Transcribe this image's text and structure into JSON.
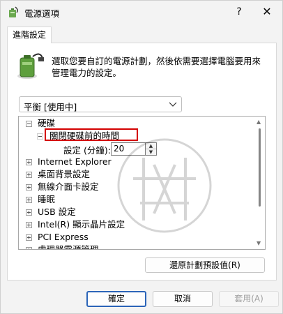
{
  "window": {
    "title": "電源選項",
    "help_glyph": "?",
    "close_glyph": "✕",
    "icon": "power-options-icon"
  },
  "tab": {
    "label": "進階設定"
  },
  "description": "選取您要自訂的電源計劃，然後依需要選擇電腦要用來管理電力的設定。",
  "plan_select": {
    "value": "平衡 [使用中]"
  },
  "tree": {
    "items": [
      {
        "label": "硬碟",
        "expander": "minus"
      },
      {
        "label": "關閉硬碟前的時間",
        "expander": "minus"
      },
      {
        "label": "Internet Explorer",
        "expander": "plus"
      },
      {
        "label": "桌面背景設定",
        "expander": "plus"
      },
      {
        "label": "無線介面卡設定",
        "expander": "plus"
      },
      {
        "label": "睡眠",
        "expander": "plus"
      },
      {
        "label": "USB 設定",
        "expander": "plus"
      },
      {
        "label": "Intel(R) 顯示晶片設定",
        "expander": "plus"
      },
      {
        "label": "PCI Express",
        "expander": "plus"
      },
      {
        "label": "處理器電源管理",
        "expander": "plus"
      }
    ],
    "setting": {
      "label": "設定 (分鐘):",
      "value": "20"
    },
    "highlight_color": "#d40000"
  },
  "buttons": {
    "restore": "還原計劃預設值(R)",
    "ok": "確定",
    "cancel": "取消",
    "apply": "套用(A)"
  },
  "colors": {
    "accent": "#2b64b8"
  }
}
